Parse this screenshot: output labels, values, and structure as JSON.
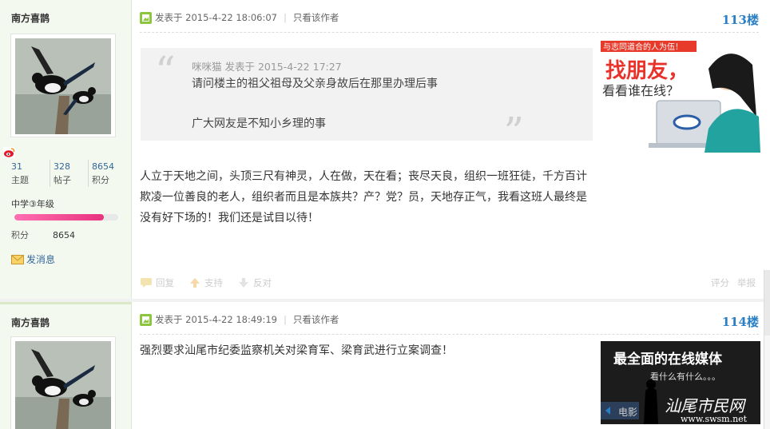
{
  "posts": [
    {
      "username": "南方喜鹊",
      "stats": [
        {
          "num": "31",
          "label": "主题"
        },
        {
          "num": "328",
          "label": "帖子"
        },
        {
          "num": "8654",
          "label": "积分"
        }
      ],
      "grade": "中学③年级",
      "points_label": "积分",
      "points_value": "8654",
      "progress_fraction": 0.86,
      "send_message": "发消息",
      "posted": "发表于 2015-4-22 18:06:07",
      "only_author": "只看该作者",
      "floor": "113楼",
      "quote": {
        "head": "咪咪猫 发表于 2015-4-22 17:27",
        "line1": "请问楼主的祖父祖母及父亲身故后在那里办理后事",
        "line2": "广大网友是不知小乡理的事"
      },
      "body": "人立于天地之间，头顶三尺有神灵，人在做，天在看；丧尽天良，组织一班狂徒，千方百计欺凌一位善良的老人，组织者而且是本族共？产？党？员，天地存正气，我看这班人最终是没有好下场的！我们还是试目以待！",
      "actions": {
        "reply": "回复",
        "support": "支持",
        "oppose": "反对",
        "rate": "评分",
        "report": "举报"
      },
      "ad": {
        "top": "与志同道合的人为伍！",
        "big": "找朋友，",
        "sub": "看看谁在线？"
      }
    },
    {
      "username": "南方喜鹊",
      "posted": "发表于 2015-4-22 18:49:19",
      "only_author": "只看该作者",
      "floor": "114楼",
      "body": "强烈要求汕尾市纪委监察机关对梁育军、梁育武进行立案调查！",
      "ad": {
        "title": "最全面的在线媒体",
        "sub": "看什么有什么。。。",
        "tab": "电影",
        "brand": "汕尾市民网",
        "url": "www.swsm.net"
      }
    }
  ],
  "colors": {
    "floor": "#2a7fc6",
    "sidebar_bg": "#f4f9f0",
    "progress": "#e8337d"
  }
}
